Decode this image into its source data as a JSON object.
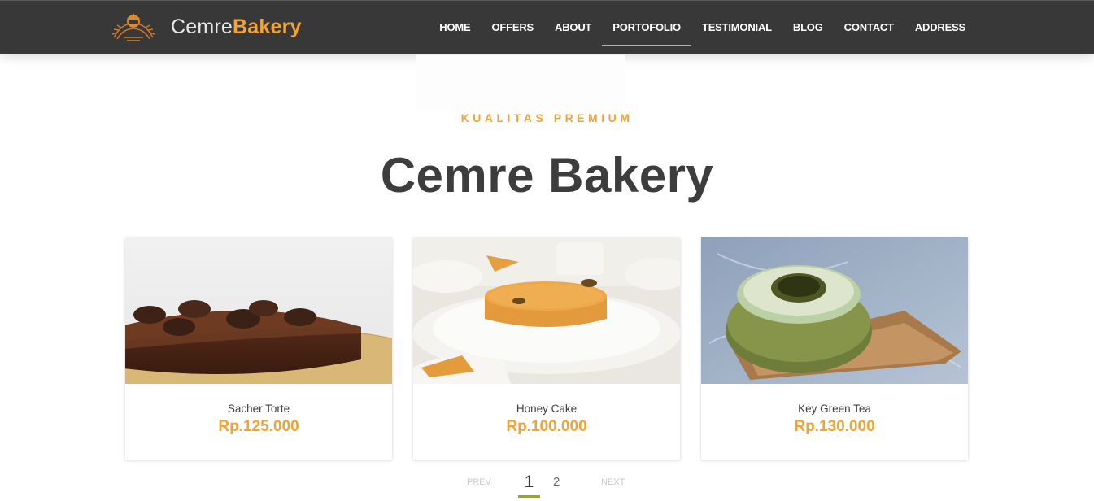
{
  "brand": {
    "name_light": "Cemre",
    "name_bold": "Bakery",
    "logo_icon": "bakery-logo-icon"
  },
  "nav": {
    "items": [
      {
        "label": "HOME"
      },
      {
        "label": "OFFERS"
      },
      {
        "label": "ABOUT"
      },
      {
        "label": "PORTOFOLIO",
        "active": true
      },
      {
        "label": "TESTIMONIAL"
      },
      {
        "label": "BLOG"
      },
      {
        "label": "CONTACT"
      },
      {
        "label": "ADDRESS"
      }
    ]
  },
  "hero": {
    "eyebrow": "KUALITAS PREMIUM",
    "title": "Cemre Bakery"
  },
  "products": [
    {
      "name": "Sacher Torte",
      "price": "Rp.125.000"
    },
    {
      "name": "Honey Cake",
      "price": "Rp.100.000"
    },
    {
      "name": "Key Green Tea",
      "price": "Rp.130.000"
    }
  ],
  "pagination": {
    "prev": "PREV",
    "pages": [
      "1",
      "2"
    ],
    "current": "1",
    "next": "NEXT"
  },
  "colors": {
    "navbar": "#383838",
    "accent": "#f2a333",
    "title": "#3d3d3d",
    "pager_underline": "#a7a50a"
  }
}
